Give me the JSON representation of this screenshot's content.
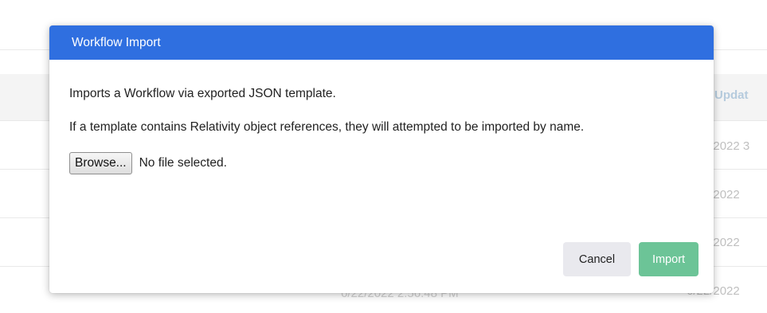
{
  "background_table": {
    "column_header": "Last Updat",
    "rows": [
      {
        "last_updated": "6/22/2022 3"
      },
      {
        "last_updated": "6/22/2022"
      },
      {
        "last_updated": "6/22/2022"
      },
      {
        "last_updated": "6/22/2022"
      }
    ],
    "partial_row_text": "6/22/2022 2:56:48 PM"
  },
  "modal": {
    "title": "Workflow Import",
    "description": "Imports a Workflow via exported JSON template.",
    "note": "If a template contains Relativity object references, they will attempted to be imported by name.",
    "browse_label": "Browse...",
    "file_status": "No file selected.",
    "cancel_label": "Cancel",
    "import_label": "Import"
  },
  "colors": {
    "header": "#2f6fe0",
    "import_button": "#6cc497",
    "cancel_button": "#e9e9ee"
  }
}
